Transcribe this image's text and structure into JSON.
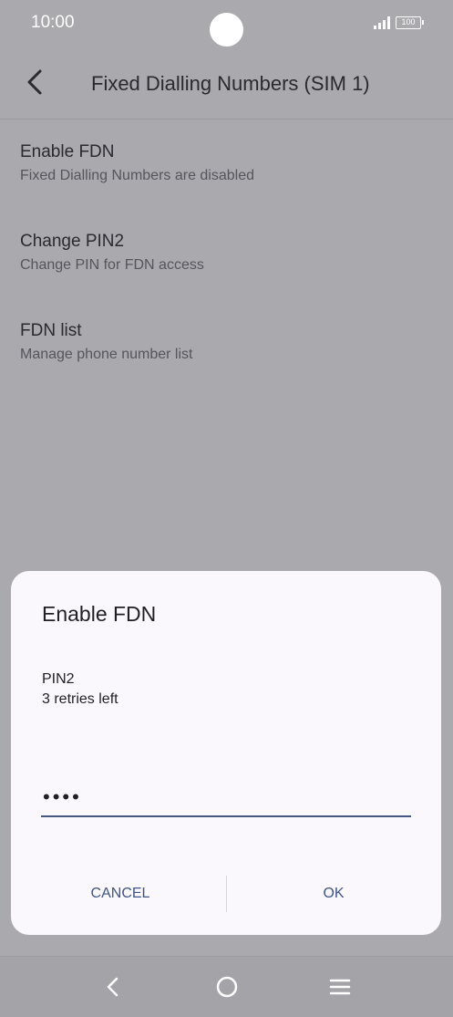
{
  "status_bar": {
    "time": "10:00",
    "battery": "100"
  },
  "header": {
    "title": "Fixed Dialling Numbers (SIM 1)"
  },
  "list": [
    {
      "title": "Enable FDN",
      "subtitle": "Fixed Dialling Numbers are disabled"
    },
    {
      "title": "Change PIN2",
      "subtitle": "Change PIN for FDN access"
    },
    {
      "title": "FDN list",
      "subtitle": "Manage phone number list"
    }
  ],
  "dialog": {
    "title": "Enable FDN",
    "message_line1": "PIN2",
    "message_line2": "3 retries left",
    "pin_value": "••••",
    "cancel_label": "CANCEL",
    "ok_label": "OK"
  },
  "nav_bar": {
    "icons": [
      "back-icon",
      "home-icon",
      "recents-icon"
    ]
  },
  "colors": {
    "scrim_background": "#a9a9ae",
    "dialog_background": "#fbf8fd",
    "accent": "#3d5488"
  }
}
